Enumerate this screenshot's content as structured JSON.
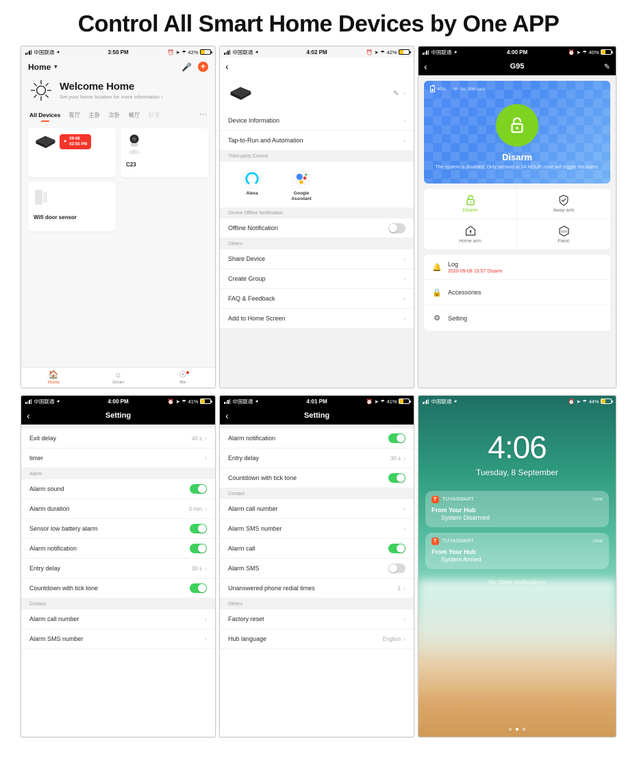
{
  "page": {
    "title": "Control All Smart Home Devices by One APP"
  },
  "screens": {
    "home": {
      "status": {
        "carrier": "中国联通",
        "time": "3:50 PM",
        "battery_pct": "42%"
      },
      "home_label": "Home",
      "welcome_title": "Welcome Home",
      "welcome_sub": "Set your home location for more information",
      "tabs": [
        {
          "label": "All Devices"
        },
        {
          "label": "客厅"
        },
        {
          "label": "主卧"
        },
        {
          "label": "次卧"
        },
        {
          "label": "餐厅"
        },
        {
          "label": "卧室"
        },
        {
          "label": "···"
        }
      ],
      "devices": [
        {
          "name": "",
          "alarm_date": "09-08",
          "alarm_time": "02:55 PM"
        },
        {
          "name": "C23"
        },
        {
          "name": "Wifi door sensor"
        }
      ],
      "tabbar": [
        {
          "label": "Home"
        },
        {
          "label": "Smart"
        },
        {
          "label": "Me"
        }
      ]
    },
    "device_detail": {
      "status": {
        "carrier": "中国联通",
        "time": "4:02 PM",
        "battery_pct": "42%"
      },
      "rows_top": [
        {
          "label": "Device Information"
        },
        {
          "label": "Tap-to-Run and Automation"
        }
      ],
      "third_party_header": "Third-party Control",
      "third_party": [
        {
          "label": "Alexa"
        },
        {
          "label": "Google Assistant"
        }
      ],
      "offline_header": "Device Offline Notification",
      "offline_row": {
        "label": "Offline Notification",
        "on": false
      },
      "others_header": "Others",
      "rows_others": [
        {
          "label": "Share Device"
        },
        {
          "label": "Create Group"
        },
        {
          "label": "FAQ & Feedback"
        },
        {
          "label": "Add to Home Screen"
        }
      ]
    },
    "panel": {
      "status": {
        "carrier": "中国联通",
        "time": "4:00 PM",
        "battery_pct": "40%"
      },
      "title": "G95",
      "hero": {
        "battery": "40%",
        "sim": "No SIM card",
        "state": "Disarm",
        "description": "The system is disabled. Only sensors in 24 HOUR zone will trigger the alarm."
      },
      "modes": [
        {
          "label": "Disarm",
          "active": true
        },
        {
          "label": "Away arm",
          "active": false
        },
        {
          "label": "Home arm",
          "active": false
        },
        {
          "label": "Panic",
          "active": false
        }
      ],
      "menu": [
        {
          "label": "Log",
          "sub": "2020-09-08 15:57 Disarm"
        },
        {
          "label": "Accessories",
          "sub": ""
        },
        {
          "label": "Setting",
          "sub": ""
        }
      ]
    },
    "setting_a": {
      "status": {
        "carrier": "中国联通",
        "time": "4:00 PM",
        "battery_pct": "41%"
      },
      "title": "Setting",
      "rows": [
        {
          "label": "Exit delay",
          "value": "40 s",
          "type": "chevron"
        },
        {
          "label": "timer",
          "value": "",
          "type": "chevron"
        },
        {
          "label": "Alarm",
          "type": "header"
        },
        {
          "label": "Alarm sound",
          "type": "toggle",
          "on": true
        },
        {
          "label": "Alarm duration",
          "value": "3 min",
          "type": "chevron"
        },
        {
          "label": "Sensor low battery alarm",
          "type": "toggle",
          "on": true
        },
        {
          "label": "Alarm notification",
          "type": "toggle",
          "on": true
        },
        {
          "label": "Entry delay",
          "value": "30 s",
          "type": "chevron"
        },
        {
          "label": "Countdown with tick tone",
          "type": "toggle",
          "on": true
        },
        {
          "label": "Contact",
          "type": "header"
        },
        {
          "label": "Alarm call number",
          "value": "",
          "type": "chevron"
        },
        {
          "label": "Alarm SMS number",
          "value": "",
          "type": "chevron"
        }
      ]
    },
    "setting_b": {
      "status": {
        "carrier": "中国联通",
        "time": "4:01 PM",
        "battery_pct": "41%"
      },
      "title": "Setting",
      "rows": [
        {
          "label": "Alarm notification",
          "type": "toggle",
          "on": true
        },
        {
          "label": "Entry delay",
          "value": "30 s",
          "type": "chevron"
        },
        {
          "label": "Countdown with tick tone",
          "type": "toggle",
          "on": true
        },
        {
          "label": "Contact",
          "type": "header"
        },
        {
          "label": "Alarm call number",
          "value": "",
          "type": "chevron"
        },
        {
          "label": "Alarm SMS number",
          "value": "",
          "type": "chevron"
        },
        {
          "label": "Alarm call",
          "type": "toggle",
          "on": true
        },
        {
          "label": "Alarm SMS",
          "type": "toggle",
          "on": false
        },
        {
          "label": "Unanswered phone redial times",
          "value": "1",
          "type": "chevron"
        },
        {
          "label": "Others",
          "type": "header"
        },
        {
          "label": "Factory reset",
          "value": "",
          "type": "chevron"
        },
        {
          "label": "Hub language",
          "value": "English",
          "type": "chevron"
        }
      ]
    },
    "lock": {
      "status": {
        "carrier": "中国联通",
        "battery_pct": "44%"
      },
      "time": "4:06",
      "date": "Tuesday, 8 September",
      "notifications": [
        {
          "app": "TUYASMART",
          "when": "now",
          "title": "From Your Hub",
          "body": "System Disarmed"
        },
        {
          "app": "TUYASMART",
          "when": "now",
          "title": "From Your Hub",
          "body": "System Armed"
        }
      ],
      "no_older": "No Older Notifications"
    }
  },
  "colors": {
    "accent_orange": "#ff5a28",
    "alarm_red": "#f5352b",
    "toggle_green": "#3ed15e",
    "disarm_green": "#7ed321",
    "panel_blue": "#4f8bf5"
  }
}
